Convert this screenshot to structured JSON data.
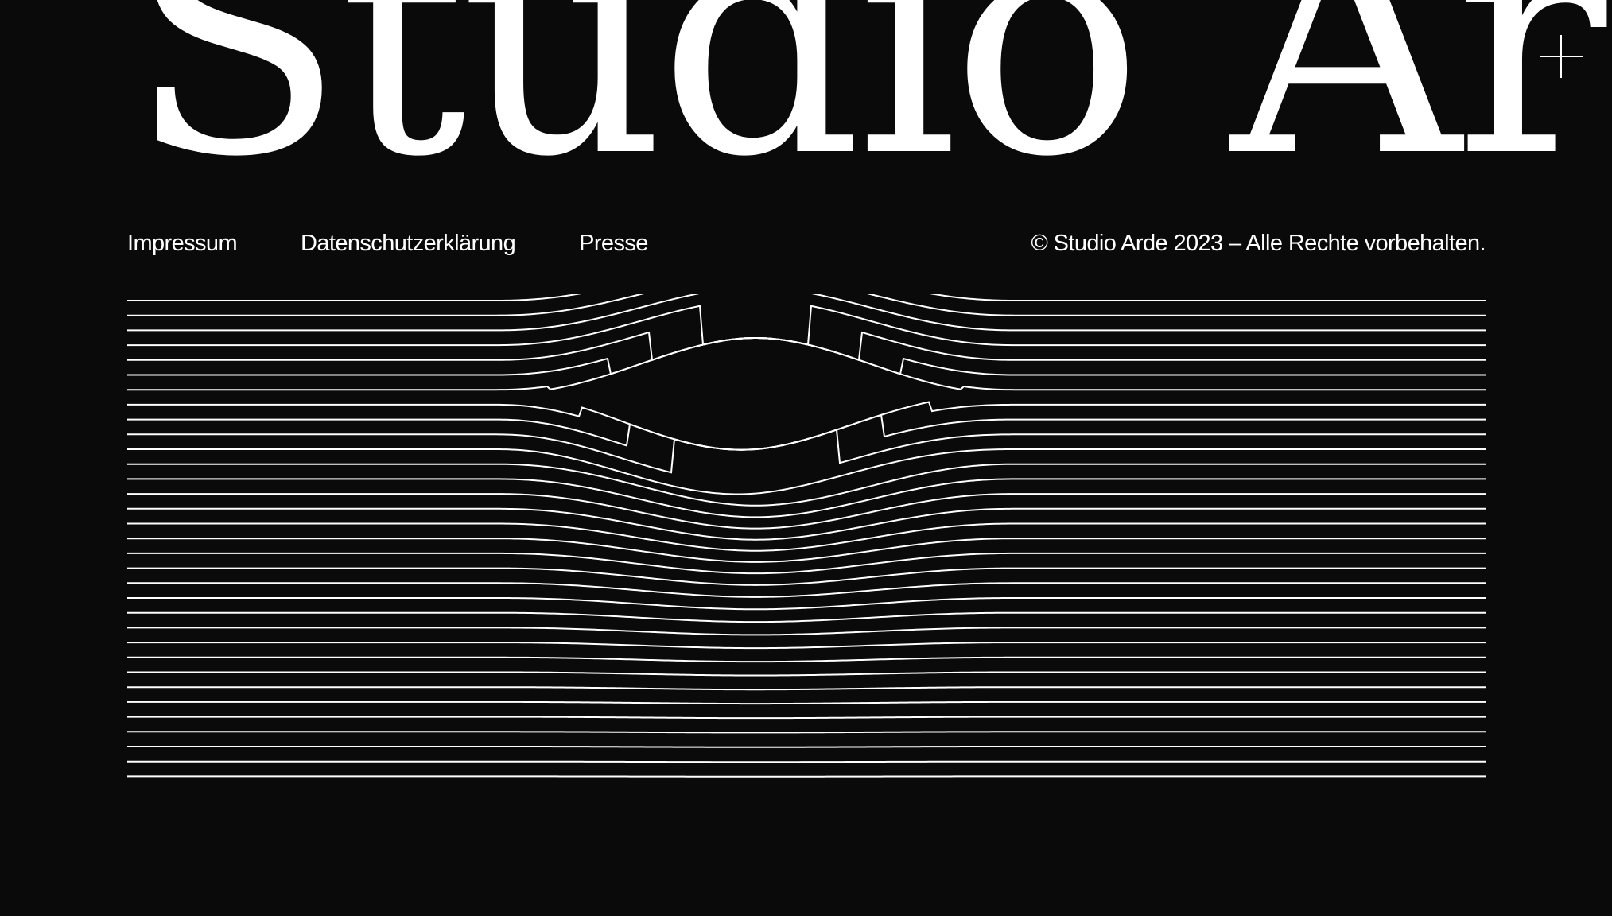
{
  "brand": {
    "name": "Studio Arde"
  },
  "menu": {
    "icon": "plus-icon"
  },
  "footer": {
    "links": [
      {
        "label": "Impressum"
      },
      {
        "label": "Datenschutzerklärung"
      },
      {
        "label": "Presse"
      }
    ],
    "copyright": "© Studio Arde 2023 – Alle Rechte vorbehalten."
  },
  "theme": {
    "background": "#0a0a0a",
    "foreground": "#ffffff"
  }
}
